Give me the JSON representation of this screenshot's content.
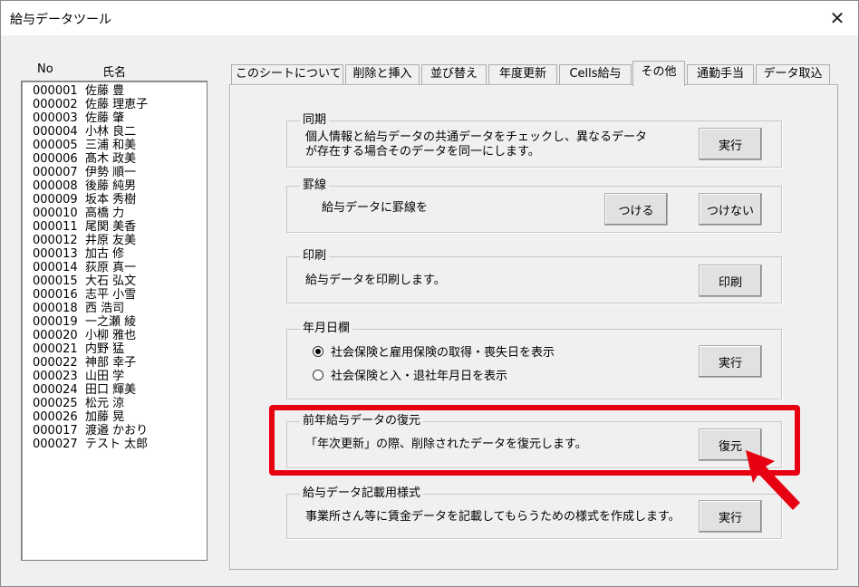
{
  "window": {
    "title": "給与データツール"
  },
  "list": {
    "col_no": "No",
    "col_name": "氏名",
    "rows": [
      {
        "no": "000001",
        "name": "佐藤 豊"
      },
      {
        "no": "000002",
        "name": "佐藤 理恵子"
      },
      {
        "no": "000003",
        "name": "佐藤 肇"
      },
      {
        "no": "000004",
        "name": "小林 良二"
      },
      {
        "no": "000005",
        "name": "三浦 和美"
      },
      {
        "no": "000006",
        "name": "髙木 政美"
      },
      {
        "no": "000007",
        "name": "伊勢 順一"
      },
      {
        "no": "000008",
        "name": "後藤 純男"
      },
      {
        "no": "000009",
        "name": "坂本 秀樹"
      },
      {
        "no": "000010",
        "name": "高橋 力"
      },
      {
        "no": "000011",
        "name": "尾関 美香"
      },
      {
        "no": "000012",
        "name": "井原 友美"
      },
      {
        "no": "000013",
        "name": "加古 修"
      },
      {
        "no": "000014",
        "name": "荻原 真一"
      },
      {
        "no": "000015",
        "name": "大石 弘文"
      },
      {
        "no": "000016",
        "name": "志平 小雪"
      },
      {
        "no": "000018",
        "name": "西 浩司"
      },
      {
        "no": "000019",
        "name": "一之瀬 綾"
      },
      {
        "no": "000020",
        "name": "小柳 雅也"
      },
      {
        "no": "000021",
        "name": "内野 猛"
      },
      {
        "no": "000022",
        "name": "神部 幸子"
      },
      {
        "no": "000023",
        "name": "山田 学"
      },
      {
        "no": "000024",
        "name": "田口 輝美"
      },
      {
        "no": "000025",
        "name": "松元 涼"
      },
      {
        "no": "000026",
        "name": "加藤 晃"
      },
      {
        "no": "000017",
        "name": "渡邉 かおり"
      },
      {
        "no": "000027",
        "name": "テスト 太郎"
      }
    ]
  },
  "tabs": [
    {
      "label": "このシートについて"
    },
    {
      "label": "削除と挿入"
    },
    {
      "label": "並び替え"
    },
    {
      "label": "年度更新"
    },
    {
      "label": "Cells給与"
    },
    {
      "label": "その他"
    },
    {
      "label": "通勤手当"
    },
    {
      "label": "データ取込"
    }
  ],
  "groups": {
    "sync": {
      "label": "同期",
      "text1": "個人情報と給与データの共通データをチェックし、異なるデータ",
      "text2": "が存在する場合そのデータを同一にします。",
      "button": "実行"
    },
    "ruled": {
      "label": "罫線",
      "text": "給与データに罫線を",
      "button_on": "つける",
      "button_off": "つけない"
    },
    "print": {
      "label": "印刷",
      "text": "給与データを印刷します。",
      "button": "印刷"
    },
    "date": {
      "label": "年月日欄",
      "option1": "社会保険と雇用保険の取得・喪失日を表示",
      "option2": "社会保険と入・退社年月日を表示",
      "button": "実行"
    },
    "restore": {
      "label": "前年給与データの復元",
      "text": "「年次更新」の際、削除されたデータを復元します。",
      "button": "復元"
    },
    "form": {
      "label": "給与データ記載用様式",
      "text": "事業所さん等に賃金データを記載してもらうための様式を作成します。",
      "button": "実行"
    }
  },
  "colors": {
    "highlight": "#e60012"
  }
}
